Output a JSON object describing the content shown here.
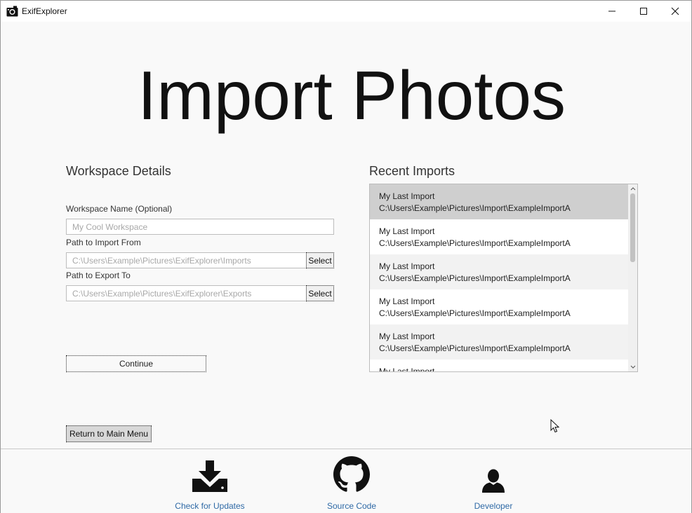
{
  "window": {
    "title": "ExifExplorer",
    "icon": "camera-icon"
  },
  "page": {
    "title": "Import Photos"
  },
  "workspace": {
    "section_title": "Workspace Details",
    "name_label": "Workspace Name (Optional)",
    "name_placeholder": "My Cool Workspace",
    "import_label": "Path to Import From",
    "import_placeholder": "C:\\Users\\Example\\Pictures\\ExifExplorer\\Imports",
    "export_label": "Path to Export To",
    "export_placeholder": "C:\\Users\\Example\\Pictures\\ExifExplorer\\Exports",
    "select_label": "Select",
    "continue_label": "Continue"
  },
  "recent": {
    "section_title": "Recent Imports",
    "items": [
      {
        "name": "My Last Import",
        "path": "C:\\Users\\Example\\Pictures\\Import\\ExampleImportA"
      },
      {
        "name": "My Last Import",
        "path": "C:\\Users\\Example\\Pictures\\Import\\ExampleImportA"
      },
      {
        "name": "My Last Import",
        "path": "C:\\Users\\Example\\Pictures\\Import\\ExampleImportA"
      },
      {
        "name": "My Last Import",
        "path": "C:\\Users\\Example\\Pictures\\Import\\ExampleImportA"
      },
      {
        "name": "My Last Import",
        "path": "C:\\Users\\Example\\Pictures\\Import\\ExampleImportA"
      },
      {
        "name": "My Last Import",
        "path": ""
      }
    ]
  },
  "return_label": "Return to Main Menu",
  "footer": {
    "updates_label": "Check for Updates",
    "source_label": "Source Code",
    "developer_label": "Developer",
    "link_color": "#2f6aa6"
  }
}
